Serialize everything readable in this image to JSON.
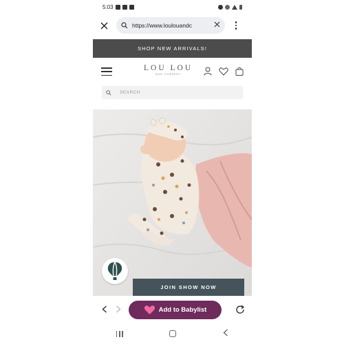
{
  "status_bar": {
    "time": "5:03"
  },
  "browser": {
    "url": "https://www.loulouandc",
    "close_icon": "close-icon",
    "menu_icon": "kebab-menu-icon"
  },
  "promo": {
    "text": "SHOP NEW ARRIVALS!"
  },
  "site_header": {
    "logo_main": "LOU LOU",
    "logo_sub": "AND COMPANY"
  },
  "search": {
    "placeholder": "SEARCH"
  },
  "hero": {
    "join_button": "JOIN SHOW NOW"
  },
  "bottom_bar": {
    "babylist_label": "Add to Babylist"
  },
  "colors": {
    "promo_bg": "#4c4c4c",
    "join_bg": "#44545a",
    "babylist_bg": "#6e2b5c",
    "heart": "#f06aa0"
  }
}
